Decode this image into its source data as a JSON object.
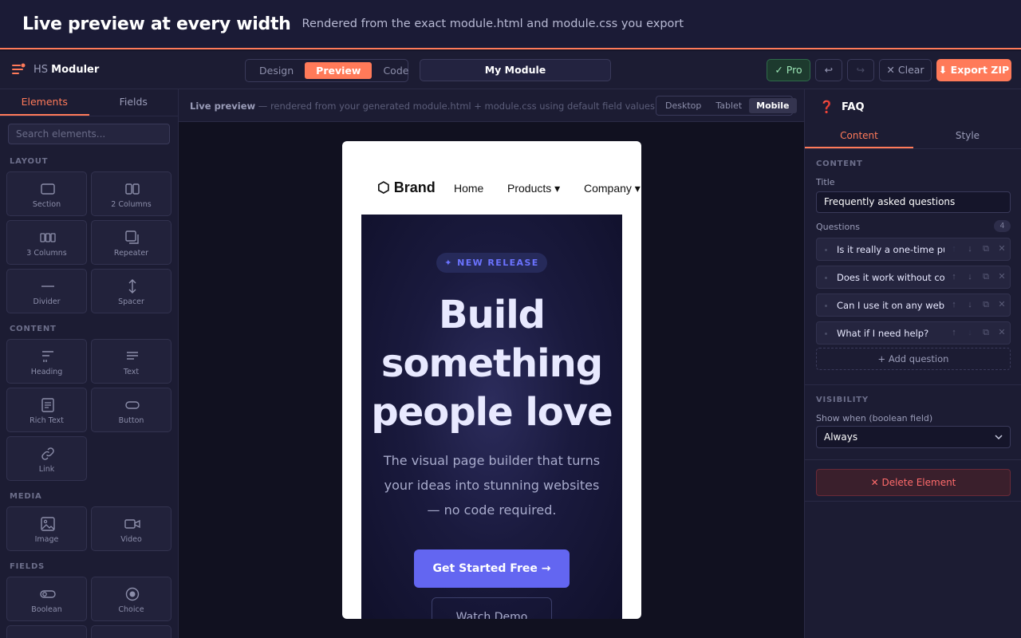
{
  "banner": {
    "title": "Live preview at every width",
    "subtitle": "Rendered from the exact module.html and module.css you export"
  },
  "topbar": {
    "logo_prefix": "HS",
    "logo_name": "Moduler",
    "modes": [
      "Design",
      "Preview",
      "Code"
    ],
    "active_mode": "Preview",
    "module_name": "My Module",
    "pro_label": "✓ Pro",
    "undo_icon": "↩",
    "redo_icon": "↪",
    "clear_label": "✕ Clear",
    "export_label": "⬇ Export ZIP",
    "colors": {
      "accent": "#ff7a59",
      "pro": "#9be5b5"
    }
  },
  "left_panel": {
    "tabs": [
      "Elements",
      "Fields"
    ],
    "active_tab": "Elements",
    "search_placeholder": "Search elements...",
    "sections": [
      {
        "label": "LAYOUT",
        "items": [
          {
            "name": "Section",
            "icon": "section-icon"
          },
          {
            "name": "2 Columns",
            "icon": "two-columns-icon"
          },
          {
            "name": "3 Columns",
            "icon": "three-columns-icon"
          },
          {
            "name": "Repeater",
            "icon": "repeater-icon"
          },
          {
            "name": "Divider",
            "icon": "divider-icon"
          },
          {
            "name": "Spacer",
            "icon": "spacer-icon"
          }
        ]
      },
      {
        "label": "CONTENT",
        "items": [
          {
            "name": "Heading",
            "icon": "heading-icon"
          },
          {
            "name": "Text",
            "icon": "text-icon"
          },
          {
            "name": "Rich Text",
            "icon": "rich-text-icon"
          },
          {
            "name": "Button",
            "icon": "button-icon"
          },
          {
            "name": "Link",
            "icon": "link-icon"
          }
        ]
      },
      {
        "label": "MEDIA",
        "items": [
          {
            "name": "Image",
            "icon": "image-icon"
          },
          {
            "name": "Video",
            "icon": "video-icon"
          }
        ]
      },
      {
        "label": "FIELDS",
        "items": [
          {
            "name": "Boolean",
            "icon": "boolean-icon"
          },
          {
            "name": "Choice",
            "icon": "choice-icon"
          }
        ]
      }
    ]
  },
  "center": {
    "note_bold": "Live preview",
    "note_rest": "— rendered from your generated module.html + module.css using default field values",
    "devices": [
      "Desktop",
      "Tablet",
      "Mobile"
    ],
    "active_device": "Mobile",
    "preview": {
      "brand": "⬡ Brand",
      "nav_links": [
        "Home",
        "Products ▾",
        "Company ▾"
      ],
      "badge": "✦ NEW RELEASE",
      "title_lines": [
        "Build",
        "something",
        "people love"
      ],
      "subtitle": "The visual page builder that turns your ideas into stunning websites — no code required.",
      "cta": "Get Started Free →",
      "secondary": "Watch Demo",
      "colors": {
        "cta": "#6366f1",
        "hero_bg": "#1a1a3e"
      }
    }
  },
  "right_panel": {
    "element_icon": "❓",
    "element_name": "FAQ",
    "tabs": [
      "Content",
      "Style"
    ],
    "active_tab": "Content",
    "content_label": "CONTENT",
    "title_label": "Title",
    "title_value": "Frequently asked questions",
    "questions_label": "Questions",
    "questions_count": "4",
    "questions": [
      "Is it really a one-time purchase?",
      "Does it work without coding?",
      "Can I use it on any website?",
      "What if I need help?"
    ],
    "add_question": "+ Add question",
    "visibility_label": "VISIBILITY",
    "show_when_label": "Show when (boolean field)",
    "show_when_value": "Always",
    "delete_label": "✕ Delete Element"
  }
}
